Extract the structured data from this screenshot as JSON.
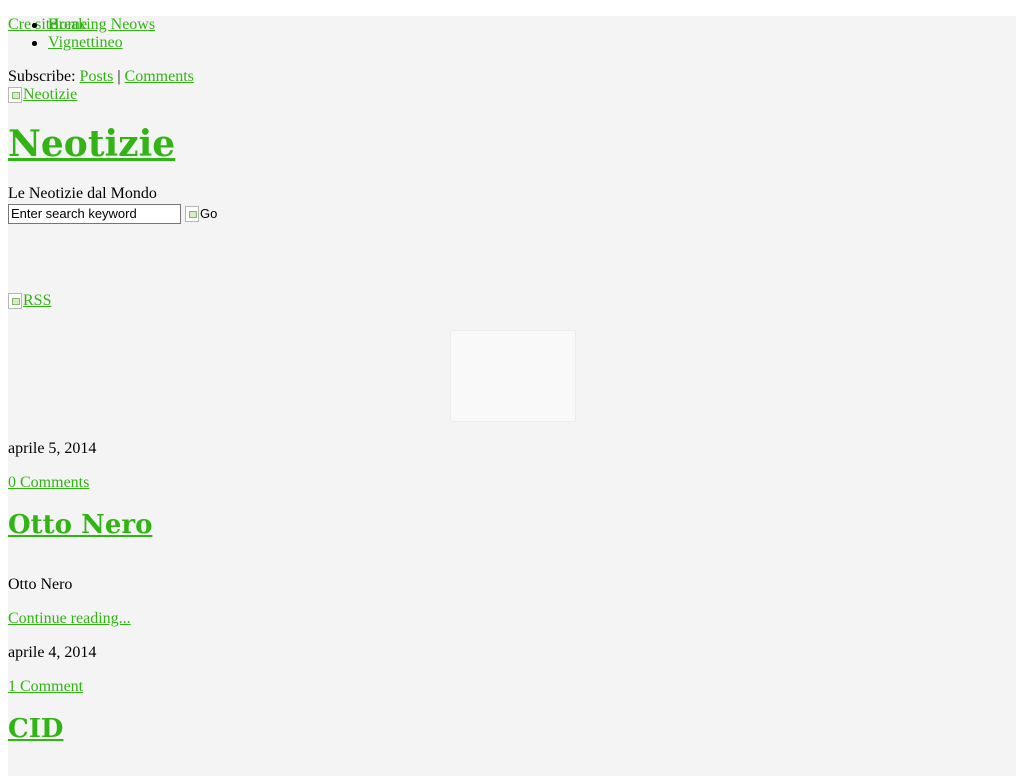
{
  "header": {
    "credits_link": "Cre site",
    "nav": [
      "Home",
      "Vignettineo"
    ],
    "subscribe_label": "Subscribe:",
    "subscribe_posts": "Posts",
    "subscribe_separator": "|",
    "subscribe_comments": "Comments",
    "logo_alt": "Neotizie",
    "site_title": "Neotizie",
    "tagline": "Le Neotizie dal Mondo"
  },
  "search": {
    "value": "Enter search keyword",
    "button_alt": "Go"
  },
  "category_nav": [
    "Breaking Neows",
    ""
  ],
  "rss_alt": "RSS",
  "posts": [
    {
      "date": "aprile 5, 2014",
      "comments": "0 Comments",
      "title": "Otto Nero",
      "excerpt": "Otto Nero",
      "continue": "Continue reading..."
    },
    {
      "date": "aprile 4, 2014",
      "comments": "1 Comment",
      "title": "CID"
    }
  ],
  "colors": {
    "link": "#33b416",
    "page_background": "#f4f4f4"
  }
}
